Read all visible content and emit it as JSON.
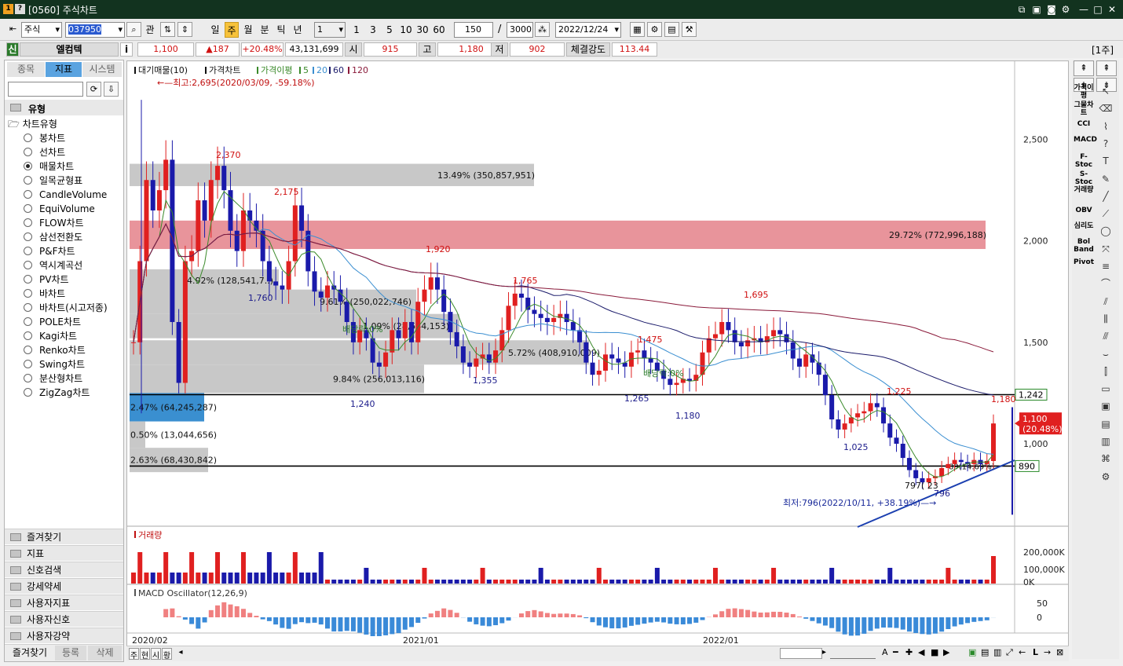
{
  "window": {
    "title": "[0560] 주식차트",
    "badge1": "1",
    "badge2": "?"
  },
  "toolbar": {
    "market": "주식",
    "code": "037950",
    "btn_gwan": "관",
    "periods": [
      "일",
      "주",
      "월",
      "분",
      "틱",
      "년"
    ],
    "interval": "1",
    "nums": [
      "1",
      "3",
      "5",
      "10",
      "30",
      "60"
    ],
    "count": "150",
    "slash": "/",
    "total": "3000",
    "date": "2022/12/24"
  },
  "quote": {
    "tag": "신",
    "name": "엘컴텍",
    "i": "i",
    "price": "1,100",
    "change": "▲187",
    "rate": "+20.48%",
    "volume": "43,131,699",
    "open_label": "시",
    "open": "915",
    "high_label": "고",
    "high": "1,180",
    "low_label": "저",
    "low": "902",
    "strength_label": "체결강도",
    "strength": "113.44",
    "unit": "[1주]"
  },
  "left": {
    "tabs": [
      "종목",
      "지표",
      "시스템"
    ],
    "tree_root": "유형",
    "tree_sub": "차트유형",
    "chart_types": [
      "봉차트",
      "선차트",
      "매물차트",
      "일목균형표",
      "CandleVolume",
      "EquiVolume",
      "FLOW차트",
      "삼선전환도",
      "P&F차트",
      "역시계곡선",
      "PV차트",
      "바차트",
      "바차트(시고저종)",
      "POLE차트",
      "Kagi차트",
      "Renko차트",
      "Swing차트",
      "분산형차트",
      "ZigZag차트"
    ],
    "selected_index": 2,
    "folders": [
      "즐겨찾기",
      "지표",
      "신호검색",
      "강세약세",
      "사용자지표",
      "사용자신호",
      "사용자강약"
    ],
    "bottom_tabs": [
      "즐겨찾기",
      "등록",
      "삭제"
    ]
  },
  "chart": {
    "legend": {
      "vol_profile": "대기매물(10)",
      "price_chart": "가격차트",
      "ma_label": "가격이평",
      "ma5": "5",
      "ma20": "20",
      "ma60": "60",
      "ma120": "120"
    },
    "max_note": "←—최고:2,695(2020/03/09, -59.18%)",
    "min_note": "최저:796(2022/10/11, +38.19%)—→",
    "y_ticks": [
      "2,500",
      "2,000",
      "1,500",
      "1,000"
    ],
    "price_levels": [
      "1,242",
      "890"
    ],
    "current": [
      "1,100",
      "(20.48%)"
    ],
    "peaks": [
      "2,370",
      "2,175",
      "1,920",
      "1,765",
      "1,695",
      "1,475",
      "1,225",
      "1,180"
    ],
    "troughs": [
      "1,760",
      "1,355",
      "1,240",
      "1,265",
      "1,180",
      "1,025",
      "796"
    ],
    "trough_extra": "797( 23",
    "profile_labels": [
      "13.49% (350,857,951)",
      "29.72% (772,996,188)",
      "4.92% (128,541,7..)",
      "9.61% (250,022,746)",
      "1.09% (28,544,153)",
      "5.72% (408,910,009)",
      "9.84% (256,013,116)",
      "2.47% (64,245,287)",
      "0.50% (13,044,656)",
      "2.63% (68,430,842)",
      "89(14.69%)"
    ],
    "dividend": "배당락:0%",
    "volume_title": "거래량",
    "volume_ticks": [
      "200,000K",
      "100,000K",
      "0K"
    ],
    "macd_title": "MACD Oscillator(12,26,9)",
    "macd_ticks": [
      "50",
      "0"
    ],
    "x_labels": [
      "2020/02",
      "2021/01",
      "2022/01"
    ],
    "colors": {
      "up": "#e02020",
      "down": "#1a1aaa",
      "ma5": "#3a8a2a",
      "ma20": "#3b8fd1",
      "ma60": "#1a1a6a",
      "ma120": "#8a1a3a",
      "profile": "#c8c8c8",
      "profile_hot": "#e8949b"
    }
  },
  "right": {
    "labels": [
      "가격이평",
      "그물차트",
      "CCI",
      "MACD",
      "F-Stoc",
      "S-Stoc",
      "거래량",
      "OBV",
      "심리도",
      "Bol Band",
      "Pivot"
    ]
  },
  "bottom": {
    "buttons": [
      "주",
      "현",
      "시",
      "황"
    ]
  }
}
